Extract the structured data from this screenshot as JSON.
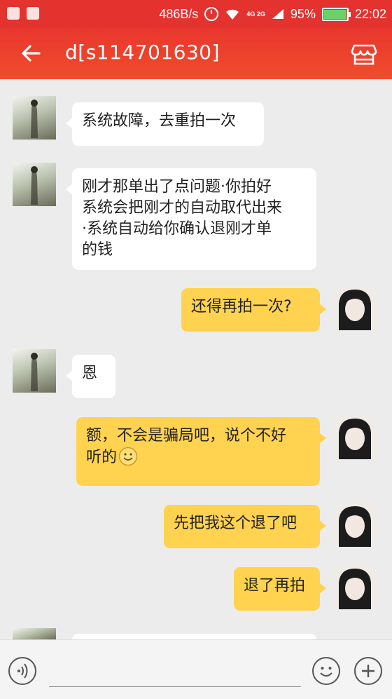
{
  "status_bar": {
    "speed": "486B/s",
    "signal": "4G 2G",
    "battery": "95%",
    "battery_level": 0.95,
    "time": "22:02",
    "color": "#e4332f"
  },
  "header": {
    "title": "d[s114701630]",
    "back_icon": "back-arrow-icon",
    "shop_icon": "store-icon"
  },
  "messages": [
    {
      "from": "shop",
      "text": "系统故障，去重拍一次"
    },
    {
      "from": "shop",
      "text": "刚才那单出了点问题·你拍好\n系统会把刚才的自动取代出来\n·系统自动给你确认退刚才单\n的钱"
    },
    {
      "from": "me",
      "text": "还得再拍一次?"
    },
    {
      "from": "shop",
      "text": "恩"
    },
    {
      "from": "me",
      "text": "额，不会是骗局吧，说个不好\n听的",
      "emoji": "smile-emoji"
    },
    {
      "from": "me",
      "text": "先把我这个退了吧"
    },
    {
      "from": "me",
      "text": "退了再拍"
    }
  ],
  "input_bar": {
    "voice_icon": "voice-icon",
    "emoji_icon": "emoji-icon",
    "plus_icon": "plus-icon"
  },
  "colors": {
    "header": "#f04c2b",
    "bubble_me": "#ffd34f",
    "bubble_shop": "#ffffff",
    "background": "#ececec"
  }
}
